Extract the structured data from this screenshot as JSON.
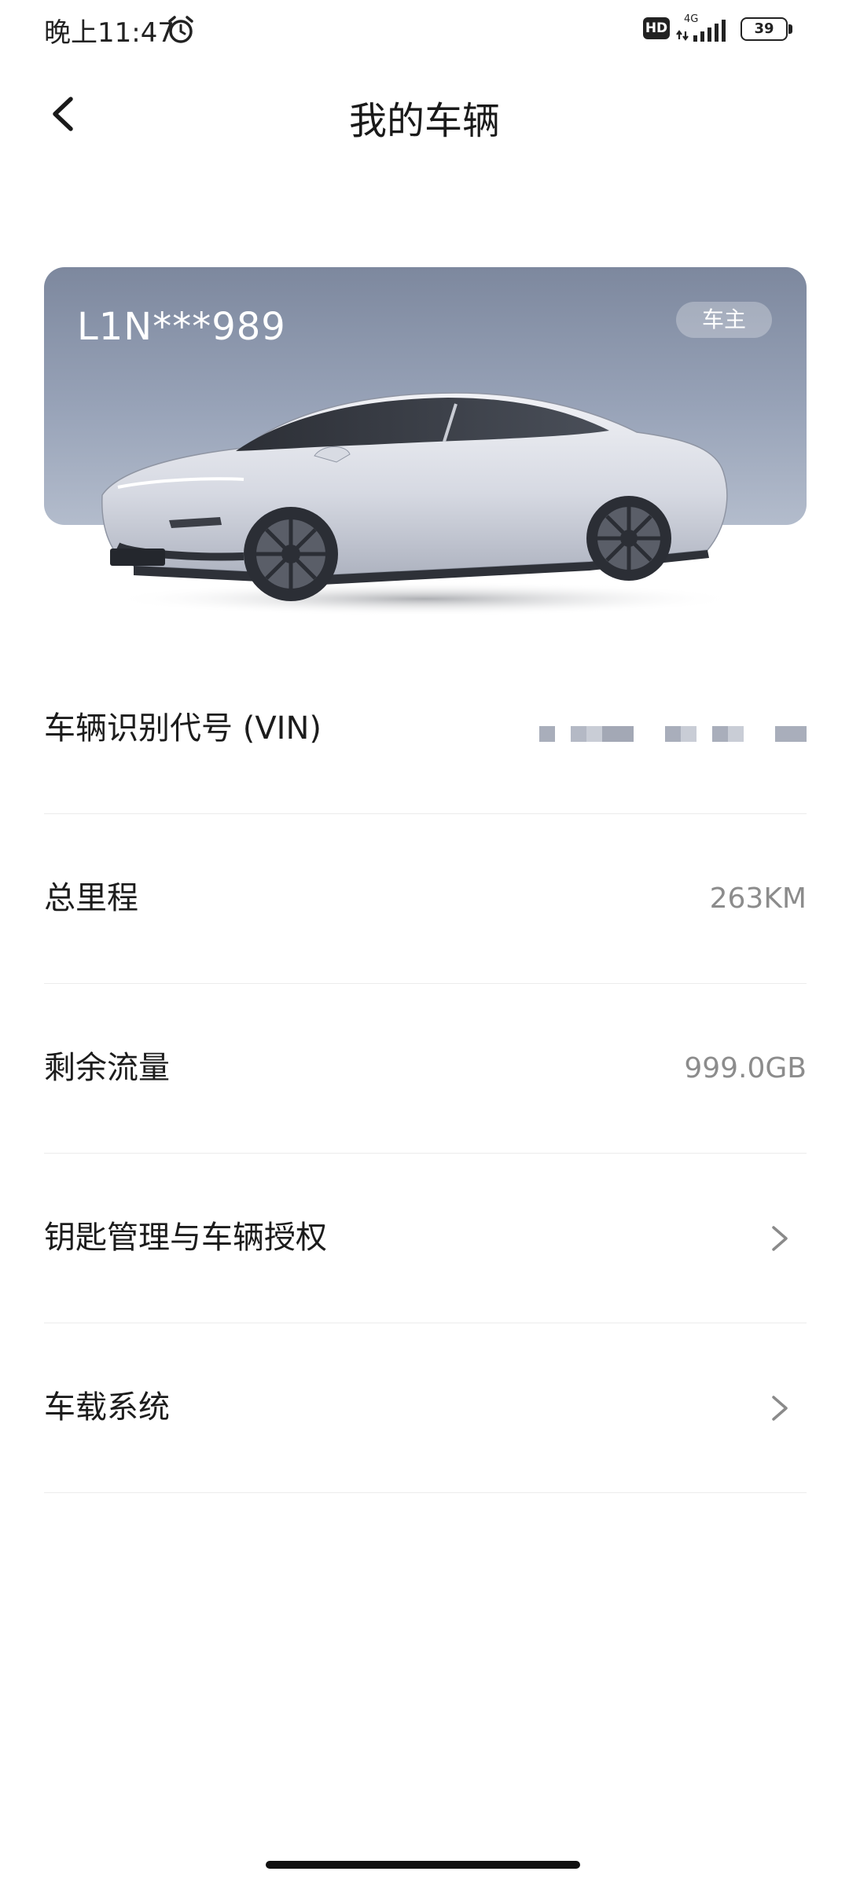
{
  "status_bar": {
    "time": "晚上11:47",
    "alarm_icon": "alarm-icon",
    "hd": "HD",
    "network": "4G",
    "battery": "39"
  },
  "header": {
    "title": "我的车辆",
    "back_icon": "chevron-left-icon"
  },
  "vehicle": {
    "plate": "L1N***989",
    "role_badge": "车主",
    "card_colors": [
      "#7d889e",
      "#b3bccc"
    ]
  },
  "rows": [
    {
      "label": "车辆识别代号 (VIN)",
      "value": "",
      "masked": true
    },
    {
      "label": "总里程",
      "value": "263KM"
    },
    {
      "label": "剩余流量",
      "value": "999.0GB"
    },
    {
      "label": "钥匙管理与车辆授权",
      "chevron": true
    },
    {
      "label": "车载系统",
      "chevron": true
    }
  ]
}
